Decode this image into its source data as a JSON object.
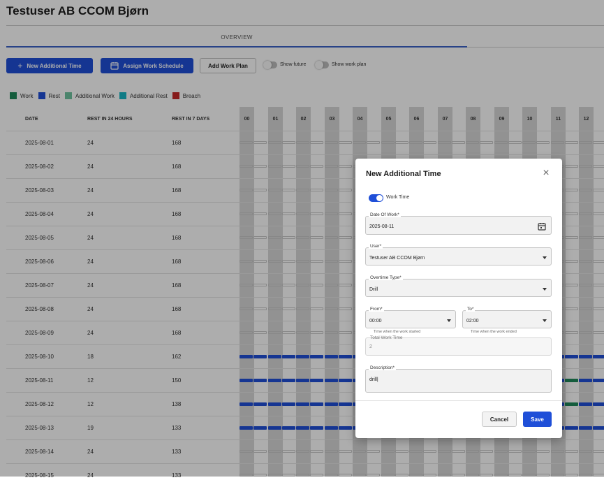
{
  "page_title": "Testuser AB CCOM Bjørn",
  "tabs": [
    {
      "label": "OVERVIEW",
      "active": true
    }
  ],
  "toolbar": {
    "new_additional_time": "New Additional Time",
    "assign_work_schedule": "Assign Work Schedule",
    "add_work_plan": "Add Work Plan",
    "show_future": "Show future",
    "show_work_plan": "Show work plan"
  },
  "legend": [
    {
      "label": "Work",
      "color": "#1f8a5a"
    },
    {
      "label": "Rest",
      "color": "#1f4fd8"
    },
    {
      "label": "Additional Work",
      "color": "#6fc3a0"
    },
    {
      "label": "Additional Rest",
      "color": "#17b5c4"
    },
    {
      "label": "Breach",
      "color": "#c62828"
    }
  ],
  "table": {
    "headers": {
      "date": "DATE",
      "rest24": "REST IN 24 HOURS",
      "rest7": "REST IN 7 DAYS"
    },
    "hours": [
      "00",
      "01",
      "02",
      "03",
      "04",
      "05",
      "06",
      "07",
      "08",
      "09",
      "10",
      "11",
      "12"
    ],
    "rows": [
      {
        "date": "2025-08-01",
        "rest24": "24",
        "rest7": "168",
        "segments": []
      },
      {
        "date": "2025-08-02",
        "rest24": "24",
        "rest7": "168",
        "segments": []
      },
      {
        "date": "2025-08-03",
        "rest24": "24",
        "rest7": "168",
        "segments": []
      },
      {
        "date": "2025-08-04",
        "rest24": "24",
        "rest7": "168",
        "segments": []
      },
      {
        "date": "2025-08-05",
        "rest24": "24",
        "rest7": "168",
        "segments": []
      },
      {
        "date": "2025-08-06",
        "rest24": "24",
        "rest7": "168",
        "segments": []
      },
      {
        "date": "2025-08-07",
        "rest24": "24",
        "rest7": "168",
        "segments": []
      },
      {
        "date": "2025-08-08",
        "rest24": "24",
        "rest7": "168",
        "segments": []
      },
      {
        "date": "2025-08-09",
        "rest24": "24",
        "rest7": "168",
        "segments": []
      },
      {
        "date": "2025-08-10",
        "rest24": "18",
        "rest7": "162",
        "segments": [
          "R",
          "R",
          "R",
          "R",
          "R",
          "R",
          "R",
          "R",
          "R",
          "R",
          "R",
          "R",
          "R",
          "R",
          "R",
          "R",
          "R",
          "R",
          "R",
          "R",
          "R",
          "R",
          "R",
          "R",
          "R",
          "R"
        ]
      },
      {
        "date": "2025-08-11",
        "rest24": "12",
        "rest7": "150",
        "segments": [
          "R",
          "R",
          "R",
          "R",
          "R",
          "R",
          "R",
          "R",
          "R",
          "R",
          "R",
          "R",
          "R",
          "R",
          "R",
          "R",
          "R",
          "R",
          "R",
          "R",
          "R",
          "R",
          "R",
          "W",
          "R",
          "R"
        ]
      },
      {
        "date": "2025-08-12",
        "rest24": "12",
        "rest7": "138",
        "segments": [
          "R",
          "R",
          "R",
          "R",
          "R",
          "R",
          "R",
          "R",
          "R",
          "R",
          "R",
          "R",
          "R",
          "R",
          "R",
          "R",
          "R",
          "R",
          "R",
          "R",
          "R",
          "R",
          "R",
          "W",
          "R",
          "R"
        ]
      },
      {
        "date": "2025-08-13",
        "rest24": "19",
        "rest7": "133",
        "segments": [
          "R",
          "R",
          "R",
          "R",
          "R",
          "R",
          "R",
          "R",
          "R",
          "R",
          "R",
          "R",
          "R",
          "R",
          "R",
          "R",
          "R",
          "R",
          "R",
          "R",
          "R",
          "R",
          "R",
          "R",
          "R",
          "R"
        ]
      },
      {
        "date": "2025-08-14",
        "rest24": "24",
        "rest7": "133",
        "segments": []
      },
      {
        "date": "2025-08-15",
        "rest24": "24",
        "rest7": "133",
        "segments": []
      }
    ]
  },
  "modal": {
    "title": "New Additional Time",
    "work_time_label": "Work Time",
    "work_time_on": true,
    "date_of_work": {
      "label": "Date Of Work*",
      "value": "2025-08-11"
    },
    "user": {
      "label": "User*",
      "value": "Testuser AB CCOM Bjørn"
    },
    "overtime_type": {
      "label": "Overtime Type*",
      "value": "Drill"
    },
    "from": {
      "label": "From*",
      "value": "00:00",
      "helper": "Time when the work started"
    },
    "to": {
      "label": "To*",
      "value": "02:00",
      "helper": "Time when the work ended"
    },
    "total_work_time": {
      "label": "Total Work Time",
      "value": "2"
    },
    "description": {
      "label": "Description*",
      "value": "drill|"
    },
    "cancel_label": "Cancel",
    "save_label": "Save"
  }
}
